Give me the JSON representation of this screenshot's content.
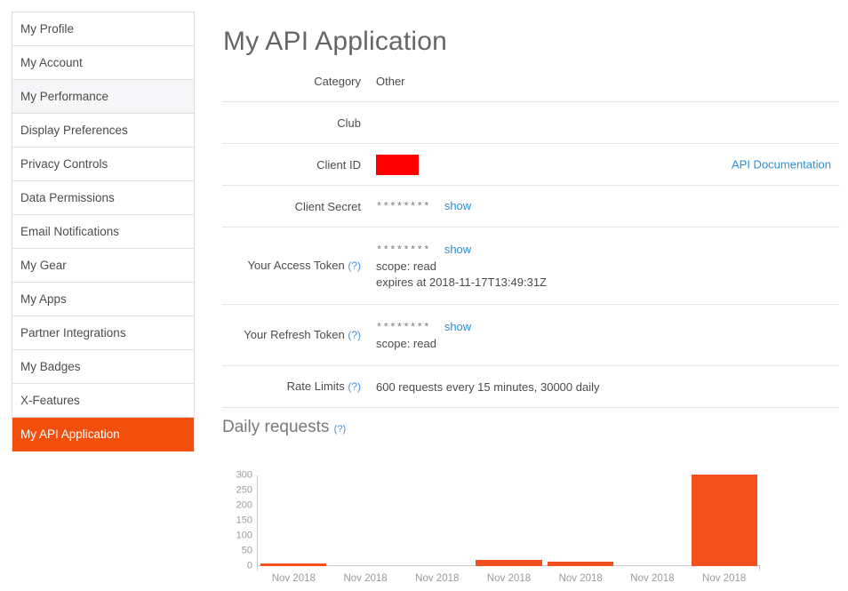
{
  "sidebar": {
    "items": [
      {
        "label": "My Profile",
        "state": "normal"
      },
      {
        "label": "My Account",
        "state": "normal"
      },
      {
        "label": "My Performance",
        "state": "hovered"
      },
      {
        "label": "Display Preferences",
        "state": "normal"
      },
      {
        "label": "Privacy Controls",
        "state": "normal"
      },
      {
        "label": "Data Permissions",
        "state": "normal"
      },
      {
        "label": "Email Notifications",
        "state": "normal"
      },
      {
        "label": "My Gear",
        "state": "normal"
      },
      {
        "label": "My Apps",
        "state": "normal"
      },
      {
        "label": "Partner Integrations",
        "state": "normal"
      },
      {
        "label": "My Badges",
        "state": "normal"
      },
      {
        "label": "X-Features",
        "state": "normal"
      },
      {
        "label": "My API Application",
        "state": "active"
      }
    ]
  },
  "main": {
    "title": "My API Application",
    "doc_link": "API Documentation",
    "help_marker": "(?)",
    "show_label": "show",
    "masked_value": "********",
    "rows": {
      "category": {
        "label": "Category",
        "value": "Other"
      },
      "club": {
        "label": "Club",
        "value": ""
      },
      "client_id": {
        "label": "Client ID",
        "value": ""
      },
      "client_secret": {
        "label": "Client Secret"
      },
      "access_token": {
        "label": "Your Access Token",
        "scope": "scope: read",
        "expires": "expires at 2018-11-17T13:49:31Z"
      },
      "refresh_token": {
        "label": "Your Refresh Token",
        "scope": "scope: read"
      },
      "rate_limits": {
        "label": "Rate Limits",
        "value": "600 requests every 15 minutes, 30000 daily"
      }
    }
  },
  "chart_data": {
    "type": "bar",
    "title": "Daily requests",
    "xlabel": "",
    "ylabel": "",
    "categories": [
      "Nov 2018",
      "Nov 2018",
      "Nov 2018",
      "Nov 2018",
      "Nov 2018",
      "Nov 2018",
      "Nov 2018"
    ],
    "values": [
      3,
      0,
      0,
      22,
      16,
      0,
      303
    ],
    "ylim": [
      0,
      300
    ],
    "yticks": [
      0,
      50,
      100,
      150,
      200,
      250,
      300
    ],
    "grid": false,
    "legend": false,
    "bar_color": "#f4511e"
  },
  "colors": {
    "accent": "#f24f0d",
    "bar": "#f4511e",
    "link": "#2d8fd5",
    "redaction": "#fe0000",
    "text": "#4c4c4c",
    "muted": "#9b9b9b"
  }
}
